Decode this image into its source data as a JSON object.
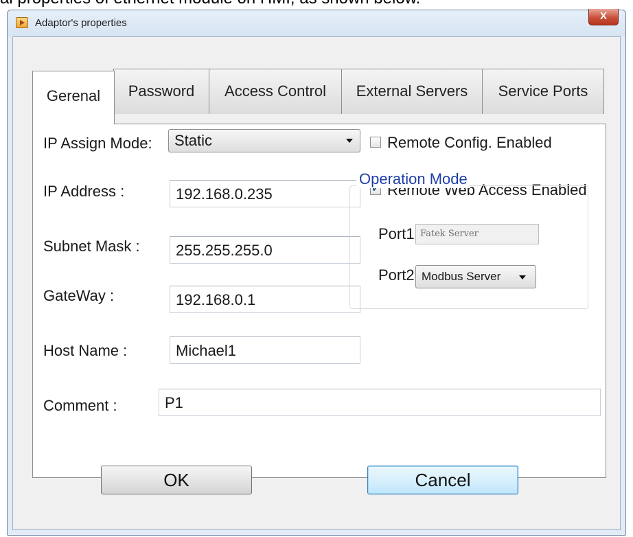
{
  "caption_text": "al properties of ethernet module on HMI, as shown below.",
  "window": {
    "title": "Adaptor's properties",
    "close_label": "X"
  },
  "tabs": [
    {
      "label": "Gerenal",
      "active": true
    },
    {
      "label": "Password",
      "active": false
    },
    {
      "label": "Access Control",
      "active": false
    },
    {
      "label": "External Servers",
      "active": false
    },
    {
      "label": "Service Ports",
      "active": false
    }
  ],
  "general": {
    "ip_assign_mode": {
      "label": "IP Assign Mode:",
      "value": "Static"
    },
    "ip_address": {
      "label": "IP Address :",
      "value": "192.168.0.235"
    },
    "subnet_mask": {
      "label": "Subnet Mask :",
      "value": "255.255.255.0"
    },
    "gateway": {
      "label": "GateWay :",
      "value": "192.168.0.1"
    },
    "host_name": {
      "label": "Host Name :",
      "value": "Michael1"
    },
    "comment": {
      "label": "Comment :",
      "value": "P1"
    },
    "remote_config": {
      "label": "Remote Config. Enabled",
      "checked": false
    },
    "remote_web": {
      "label": "Remote Web Access Enabled",
      "checked": true
    }
  },
  "operation_mode": {
    "title": "Operation Mode",
    "port1": {
      "label": "Port1:",
      "value": "Fatek Server"
    },
    "port2": {
      "label": "Port2:",
      "value": "Modbus Server"
    }
  },
  "buttons": {
    "ok": "OK",
    "cancel": "Cancel"
  },
  "colors": {
    "group_title": "#1f3fa5",
    "close_button": "#c9503a",
    "default_button_border": "#3c7fb1"
  }
}
